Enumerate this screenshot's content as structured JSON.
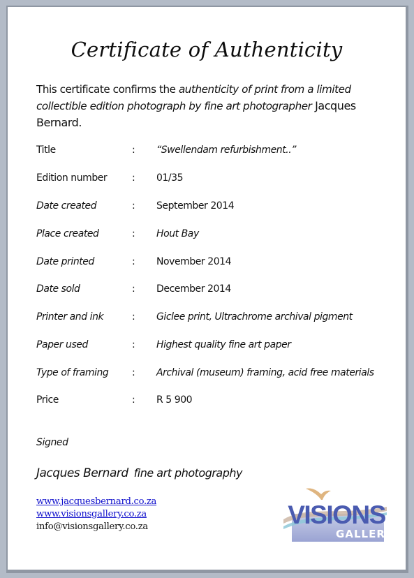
{
  "certificate": {
    "title": "Certificate of Authenticity",
    "intro": {
      "part1": "This certificate confirms the ",
      "part2_italic": "authenticity of print from a limited collectible edition photograph by fine art photographer",
      "photographer": " Jacques Bernard."
    },
    "fields": [
      {
        "label": "Title",
        "separator": ":",
        "value": "“Swellendam refurbishment..”"
      },
      {
        "label": "Edition number",
        "separator": ":",
        "value": "01/35"
      },
      {
        "label": "Date created",
        "separator": ":",
        "value": "September 2014"
      },
      {
        "label": "Place created",
        "separator": ":",
        "value": "Hout Bay"
      },
      {
        "label": "Date printed",
        "separator": ":",
        "value": "November 2014"
      },
      {
        "label": "Date sold",
        "separator": ":",
        "value": "December 2014"
      },
      {
        "label": "Printer and ink",
        "separator": ":",
        "value": "Giclee print, Ultrachrome archival pigment"
      },
      {
        "label": "Paper used",
        "separator": ":",
        "value": "Highest quality fine art paper"
      },
      {
        "label": "Type of framing",
        "separator": ":",
        "value": "Archival (museum) framing, acid free materials"
      },
      {
        "label": "Price",
        "separator": ":",
        "value": "R 5 900"
      }
    ],
    "signed_label": "Signed",
    "signature": {
      "name": "Jacques Bernard",
      "tagline": "fine art photography"
    },
    "contacts": {
      "website1": "www.jacquesbernard.co.za",
      "website2": "www.visionsgallery.co.za",
      "email": "info@visionsgallery.co.za"
    },
    "logo": {
      "word1": "VISIONS",
      "word2": "GALLERY",
      "colors": {
        "primary": "#4a5bb0",
        "band": "#a8b0d8",
        "bird": "#d9a86a",
        "swoosh_blue": "#8ec8d8",
        "swoosh_tan": "#c9b3a0"
      }
    }
  }
}
